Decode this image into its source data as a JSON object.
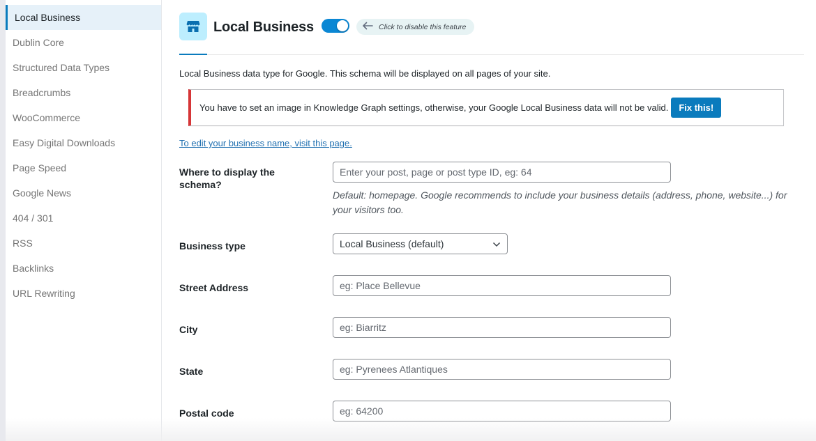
{
  "sidebar": {
    "items": [
      {
        "label": "Local Business",
        "active": true
      },
      {
        "label": "Dublin Core"
      },
      {
        "label": "Structured Data Types"
      },
      {
        "label": "Breadcrumbs"
      },
      {
        "label": "WooCommerce"
      },
      {
        "label": "Easy Digital Downloads"
      },
      {
        "label": "Page Speed"
      },
      {
        "label": "Google News"
      },
      {
        "label": "404 / 301"
      },
      {
        "label": "RSS"
      },
      {
        "label": "Backlinks"
      },
      {
        "label": "URL Rewriting"
      }
    ]
  },
  "header": {
    "icon": "storefront-icon",
    "title": "Local Business",
    "toggle_state": "on",
    "hint": "Click to disable this feature"
  },
  "main": {
    "description": "Local Business data type for Google. This schema will be displayed on all pages of your site.",
    "notice": {
      "text": "You have to set an image in Knowledge Graph settings, otherwise, your Google Local Business data will not be valid.",
      "button_label": "Fix this!"
    },
    "edit_link": "To edit your business name, visit this page.",
    "fields": {
      "display": {
        "label": "Where to display the schema?",
        "placeholder": "Enter your post, page or post type ID, eg: 64",
        "value": "",
        "help": "Default: homepage. Google recommends to include your business details (address, phone, website...) for your visitors too."
      },
      "business_type": {
        "label": "Business type",
        "selected": "Local Business (default)"
      },
      "street": {
        "label": "Street Address",
        "placeholder": "eg: Place Bellevue",
        "value": ""
      },
      "city": {
        "label": "City",
        "placeholder": "eg: Biarritz",
        "value": ""
      },
      "state": {
        "label": "State",
        "placeholder": "eg: Pyrenees Atlantiques",
        "value": ""
      },
      "postal": {
        "label": "Postal code",
        "placeholder": "eg: 64200",
        "value": ""
      }
    }
  },
  "colors": {
    "accent": "#0a7bbd",
    "notice_error": "#d63638",
    "icon_bg": "#bdeefe",
    "active_bg": "#e6f1f9"
  }
}
